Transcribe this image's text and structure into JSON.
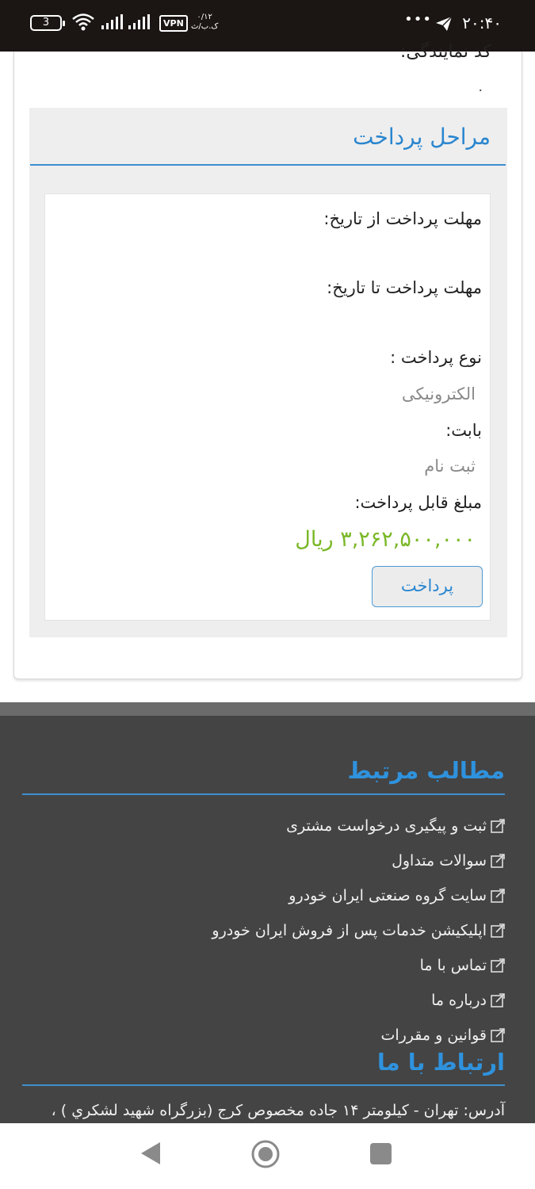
{
  "status_bar": {
    "time": "۲۰:۴۰",
    "dots": "•••",
    "battery": "3",
    "vpn": "VPN",
    "speed_value": "۰/۱۲",
    "speed_unit": "ک.ب/ث"
  },
  "card": {
    "representative_label": "کد نمایندگی:",
    "representative_value": "۰"
  },
  "payment_steps": {
    "title": "مراحل پرداخت",
    "deadline_from_label": "مهلت پرداخت از تاریخ:",
    "deadline_to_label": "مهلت پرداخت تا تاریخ:",
    "payment_type_label": "نوع پرداخت :",
    "payment_type_value": "الکترونیکی",
    "for_label": "بابت:",
    "for_value": "ثبت نام",
    "amount_label": "مبلغ قابل پرداخت:",
    "amount_value": "۳,۲۶۲,۵۰۰,۰۰۰ ریال",
    "pay_button": "پرداخت"
  },
  "footer": {
    "related_title": "مطالب مرتبط",
    "links": [
      "ثبت و پیگیری درخواست مشتری",
      "سوالات متداول",
      "سایت گروه صنعتی ایران خودرو",
      "اپلیکیشن خدمات پس از فروش ایران خودرو",
      "تماس با ما",
      "درباره ما",
      "قوانین و مقررات"
    ],
    "contact_title": "ارتباط با ما",
    "address": "آدرس: تهران - کیلومتر ۱۴ جاده مخصوص کرج (بزرگراه شهید لشکري ) ،"
  },
  "colors": {
    "accent_blue": "#2a86cf",
    "amount_green": "#7ab827",
    "footer_bg": "#444444",
    "status_bg": "#1b1614"
  }
}
